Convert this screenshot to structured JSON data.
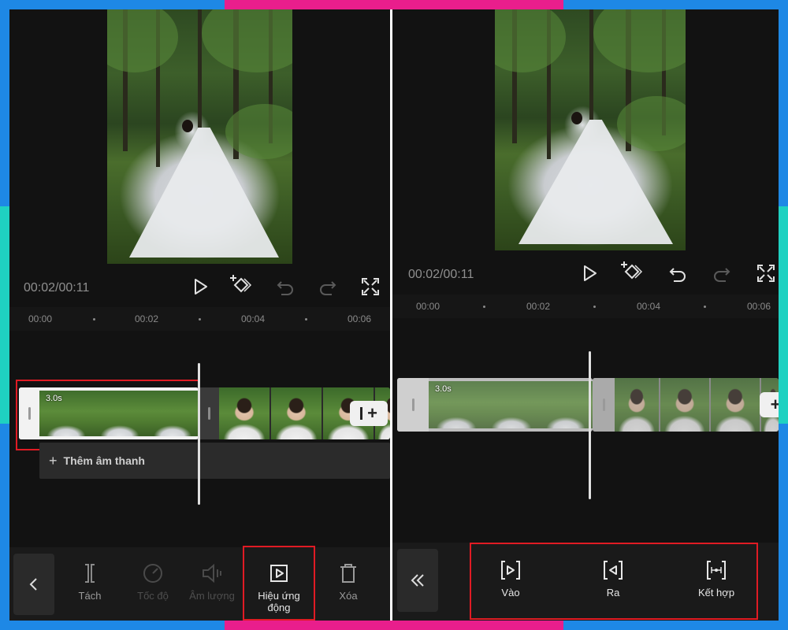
{
  "left": {
    "timecode": "00:02/00:11",
    "ruler": [
      "00:00",
      "00:02",
      "00:04",
      "00:06"
    ],
    "clip": {
      "duration": "3.0s"
    },
    "add_audio_label": "Thêm âm thanh",
    "toolbar": {
      "items": [
        {
          "label": "Tách",
          "icon": "split-icon"
        },
        {
          "label": "Tốc độ",
          "icon": "speed-icon"
        },
        {
          "label": "Âm lượng",
          "icon": "volume-icon"
        },
        {
          "label": "Hiệu ứng động",
          "icon": "animation-icon",
          "line1": "Hiệu ứng",
          "line2": "động"
        },
        {
          "label": "Xóa",
          "icon": "delete-icon"
        }
      ]
    }
  },
  "right": {
    "timecode": "00:02/00:11",
    "ruler": [
      "00:00",
      "00:02",
      "00:04",
      "00:06"
    ],
    "clip": {
      "duration": "3.0s"
    },
    "animation_options": [
      {
        "label": "Vào",
        "icon": "animation-in-icon"
      },
      {
        "label": "Ra",
        "icon": "animation-out-icon"
      },
      {
        "label": "Kết hợp",
        "icon": "animation-combo-icon"
      }
    ]
  },
  "colors": {
    "highlight": "#e01b24",
    "background": "#121212",
    "frame_blue": "#1e88e5",
    "frame_pink": "#e91e8c",
    "frame_teal": "#1fd1c1"
  }
}
